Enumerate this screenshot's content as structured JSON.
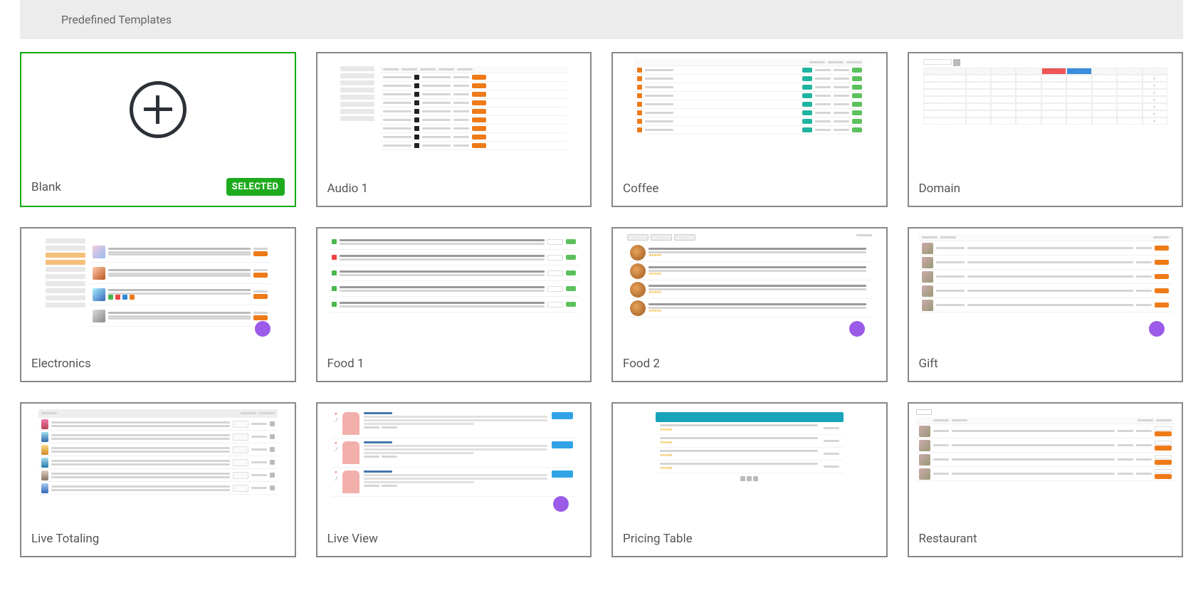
{
  "header": {
    "title": "Predefined Templates"
  },
  "badge": {
    "selected_label": "SELECTED"
  },
  "templates": [
    {
      "id": "blank",
      "label": "Blank",
      "selected": true
    },
    {
      "id": "audio1",
      "label": "Audio 1",
      "selected": false
    },
    {
      "id": "coffee",
      "label": "Coffee",
      "selected": false
    },
    {
      "id": "domain",
      "label": "Domain",
      "selected": false
    },
    {
      "id": "electronics",
      "label": "Electronics",
      "selected": false
    },
    {
      "id": "food1",
      "label": "Food 1",
      "selected": false
    },
    {
      "id": "food2",
      "label": "Food 2",
      "selected": false
    },
    {
      "id": "gift",
      "label": "Gift",
      "selected": false
    },
    {
      "id": "livetotaling",
      "label": "Live Totaling",
      "selected": false
    },
    {
      "id": "liveview",
      "label": "Live View",
      "selected": false
    },
    {
      "id": "pricingtable",
      "label": "Pricing Table",
      "selected": false
    },
    {
      "id": "restaurant",
      "label": "Restaurant",
      "selected": false
    }
  ]
}
